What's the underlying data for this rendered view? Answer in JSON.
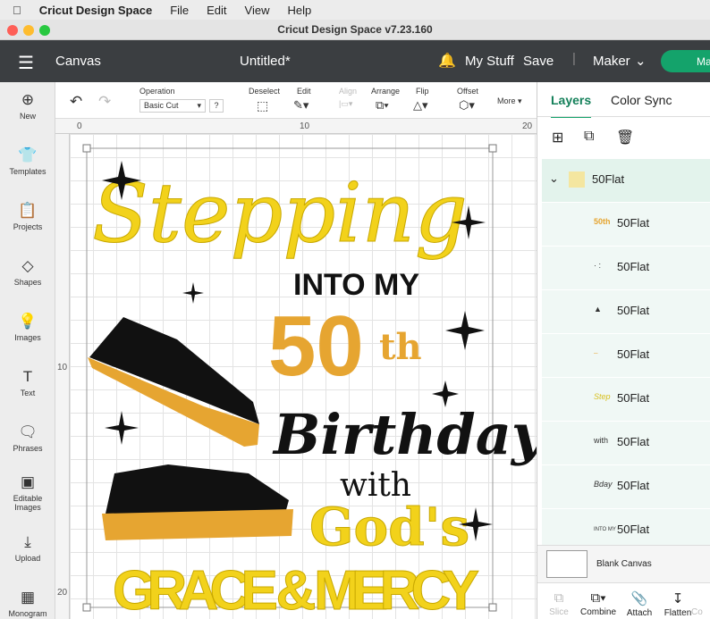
{
  "menubar": {
    "app": "Cricut Design Space",
    "items": [
      "File",
      "Edit",
      "View",
      "Help"
    ]
  },
  "window": {
    "title": "Cricut Design Space  v7.23.160"
  },
  "header": {
    "section": "Canvas",
    "doc_title": "Untitled*",
    "my_stuff": "My Stuff",
    "save": "Save",
    "machine": "Maker",
    "make_button": "Ma"
  },
  "sidebar": [
    {
      "label": "New",
      "icon": "plus-circle-icon"
    },
    {
      "label": "Templates",
      "icon": "shirt-icon"
    },
    {
      "label": "Projects",
      "icon": "clipboard-icon"
    },
    {
      "label": "Shapes",
      "icon": "shapes-icon"
    },
    {
      "label": "Images",
      "icon": "lightbulb-icon"
    },
    {
      "label": "Text",
      "icon": "text-icon"
    },
    {
      "label": "Phrases",
      "icon": "speech-icon"
    },
    {
      "label": "Editable Images",
      "icon": "edit-image-icon"
    },
    {
      "label": "Upload",
      "icon": "upload-icon"
    },
    {
      "label": "Monogram",
      "icon": "monogram-icon"
    }
  ],
  "toolbar": {
    "operation_label": "Operation",
    "operation_value": "Basic Cut",
    "help": "?",
    "deselect": "Deselect",
    "edit": "Edit",
    "align": "Align",
    "arrange": "Arrange",
    "flip": "Flip",
    "offset": "Offset",
    "more": "More"
  },
  "ruler": {
    "h": [
      "0",
      "10",
      "20"
    ],
    "v": [
      "10",
      "20"
    ]
  },
  "artwork": {
    "line1": "Stepping",
    "line2": "INTO MY",
    "line3": "50",
    "line3b": "th",
    "line4": "Birthday",
    "line5": "with",
    "line6": "God's",
    "line7": "GRACE & MERCY",
    "colors": {
      "yellow": "#f2d21b",
      "orange": "#e6a531",
      "black": "#111111"
    }
  },
  "panel": {
    "tabs": [
      "Layers",
      "Color Sync"
    ],
    "group": "50Flat",
    "layers": [
      {
        "name": "50Flat",
        "thumb": "50th"
      },
      {
        "name": "50Flat",
        "thumb": "· :"
      },
      {
        "name": "50Flat",
        "thumb": "▲"
      },
      {
        "name": "50Flat",
        "thumb": "⎯"
      },
      {
        "name": "50Flat",
        "thumb": "Step"
      },
      {
        "name": "50Flat",
        "thumb": "with"
      },
      {
        "name": "50Flat",
        "thumb": "Bday"
      },
      {
        "name": "50Flat",
        "thumb": "INTO MY"
      }
    ],
    "blank_canvas": "Blank Canvas",
    "actions": [
      "Slice",
      "Combine",
      "Attach",
      "Flatten",
      "Co"
    ]
  }
}
